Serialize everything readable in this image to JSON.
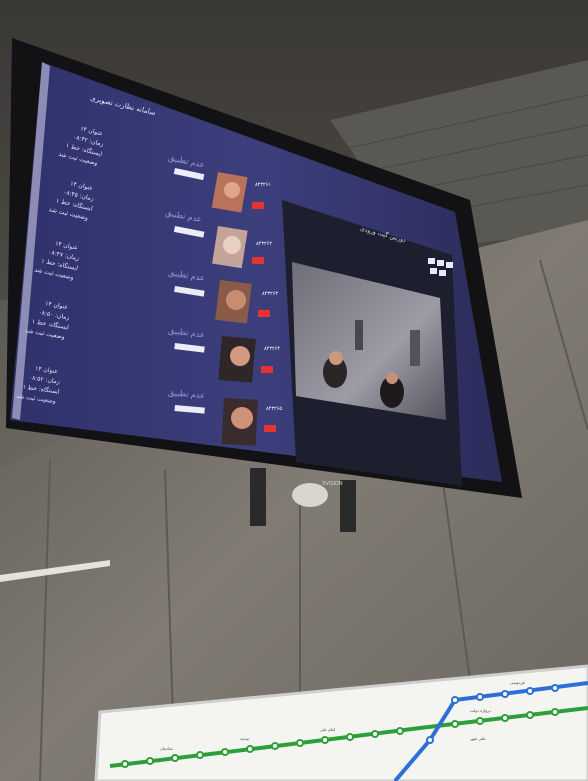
{
  "photo": {
    "subject": "Wall-mounted monitor in a metro station showing a face-recognition interface"
  },
  "monitor": {
    "brand": "XVISION",
    "header_text": "سامانه نظارت تصویری",
    "video_header": "دوربین گیت ورودی",
    "side_panel_lines": [
      [
        "عنوان ۱۴",
        "زمان: ۰۸:۴۲",
        "ایستگاه: خط ۱",
        "وضعیت ثبت شد"
      ],
      [
        "عنوان ۱۴",
        "زمان: ۰۸:۴۵",
        "ایستگاه: خط ۱",
        "وضعیت ثبت شد"
      ],
      [
        "عنوان ۱۴",
        "زمان: ۰۸:۴۷",
        "ایستگاه: خط ۱",
        "وضعیت ثبت شد"
      ],
      [
        "عنوان ۱۴",
        "زمان: ۰۸:۵۰",
        "ایستگاه: خط ۱",
        "وضعیت ثبت شد"
      ],
      [
        "عنوان ۱۴",
        "زمان: ۰۸:۵۲",
        "ایستگاه: خط ۱",
        "وضعیت ثبت شد"
      ]
    ],
    "cards": [
      {
        "title": "عدم تطبیق",
        "id": "۸۴۳۲۶۱",
        "badge": "!"
      },
      {
        "title": "عدم تطبیق",
        "id": "۸۴۳۲۶۲",
        "badge": "!"
      },
      {
        "title": "عدم تطبیق",
        "id": "۸۴۳۲۶۳",
        "badge": "!"
      },
      {
        "title": "عدم تطبیق",
        "id": "۸۴۳۲۶۴",
        "badge": "!"
      },
      {
        "title": "عدم تطبیق",
        "id": "۸۴۳۲۶۵",
        "badge": "!"
      }
    ]
  },
  "metro_map": {
    "station_labels": [
      "شادمان",
      "توحید",
      "امام علی",
      "دروازه دولت",
      "فردوسی",
      "تئاتر شهر"
    ]
  },
  "colors": {
    "screen_bg": "#3b3d7a",
    "card_bg": "#34366d",
    "accent_red": "#e33333",
    "line_green": "#2e9e3a",
    "line_blue": "#2c6fd6",
    "wall": "#7b776f"
  }
}
